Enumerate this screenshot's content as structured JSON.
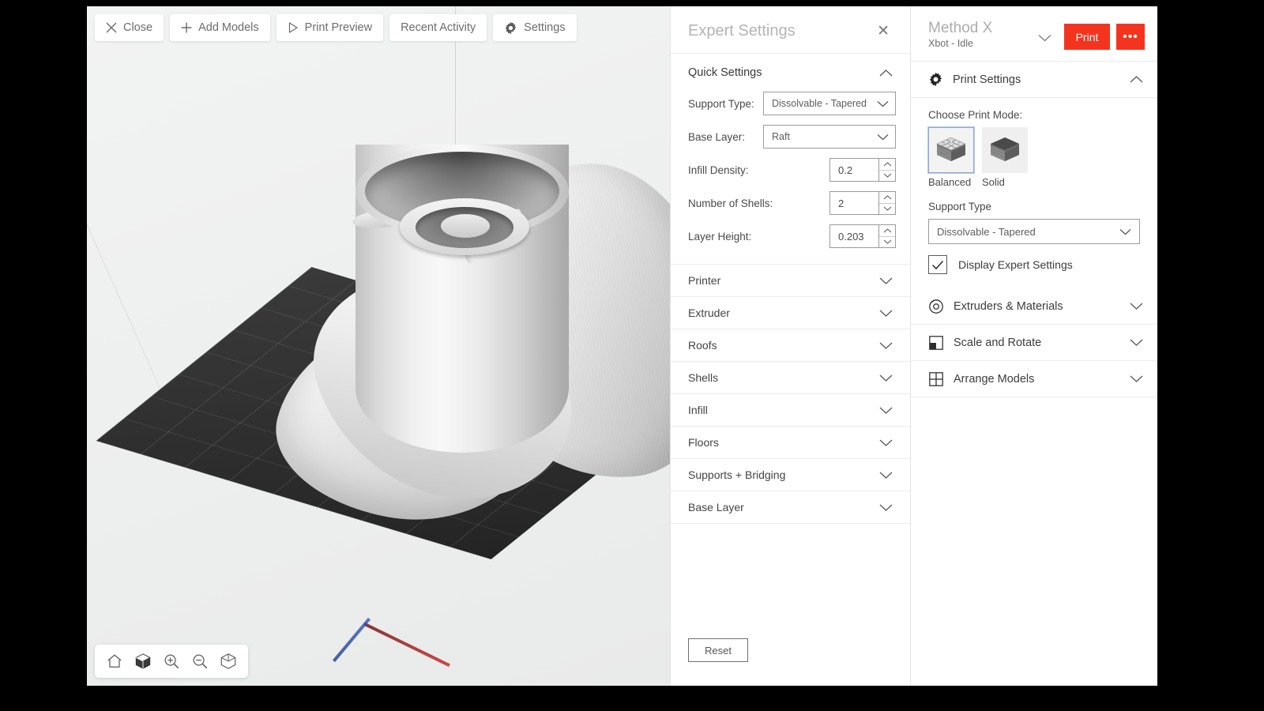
{
  "toolbar": {
    "buttons": [
      {
        "label": "Close",
        "icon": "close-icon"
      },
      {
        "label": "Add Models",
        "icon": "plus-icon"
      },
      {
        "label": "Print Preview",
        "icon": "play-icon"
      },
      {
        "label": "Recent Activity",
        "icon": "none"
      },
      {
        "label": "Settings",
        "icon": "gear-icon"
      }
    ]
  },
  "viewport": {
    "tools": [
      {
        "name": "home-icon"
      },
      {
        "name": "view-cube-icon"
      },
      {
        "name": "zoom-in-icon"
      },
      {
        "name": "zoom-out-icon"
      },
      {
        "name": "bounding-box-icon"
      }
    ]
  },
  "expert": {
    "title": "Expert Settings",
    "close": "✕",
    "quick_settings_label": "Quick Settings",
    "fields": [
      {
        "label": "Support Type:",
        "value": "Dissolvable - Tapered",
        "type": "select"
      },
      {
        "label": "Base Layer:",
        "value": "Raft",
        "type": "select"
      },
      {
        "label": "Infill Density:",
        "value": "0.2",
        "type": "number"
      },
      {
        "label": "Number of Shells:",
        "value": "2",
        "type": "number"
      },
      {
        "label": "Layer Height:",
        "value": "0.203",
        "type": "number"
      }
    ],
    "sections": [
      {
        "label": "Printer"
      },
      {
        "label": "Extruder"
      },
      {
        "label": "Roofs"
      },
      {
        "label": "Shells"
      },
      {
        "label": "Infill"
      },
      {
        "label": "Floors"
      },
      {
        "label": "Supports + Bridging"
      },
      {
        "label": "Base Layer"
      }
    ],
    "reset_label": "Reset"
  },
  "right": {
    "printer_name": "Method X",
    "printer_status": "Xbot - Idle",
    "print_label": "Print",
    "more_label": "•••",
    "accent_color": "#f5341f",
    "print_settings_label": "Print Settings",
    "choose_mode_label": "Choose Print Mode:",
    "modes": [
      {
        "label": "Balanced",
        "selected": true
      },
      {
        "label": "Solid",
        "selected": false
      }
    ],
    "support_type_label": "Support Type",
    "support_type_value": "Dissolvable - Tapered",
    "display_expert_label": "Display Expert Settings",
    "display_expert_checked": true,
    "sections": [
      {
        "label": "Extruders & Materials",
        "icon": "spool-icon"
      },
      {
        "label": "Scale and Rotate",
        "icon": "scale-icon"
      },
      {
        "label": "Arrange Models",
        "icon": "grid-icon"
      }
    ]
  }
}
